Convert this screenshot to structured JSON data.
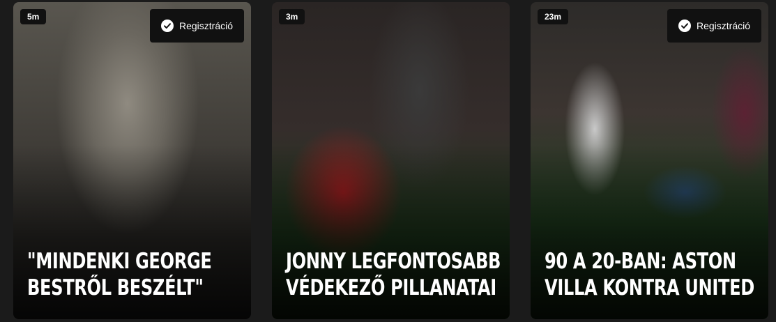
{
  "cards": [
    {
      "time": "5m",
      "register_label": "Regisztráció",
      "title_line1": "\"MINDENKI GEORGE",
      "title_line2": "BESTRŐL BESZÉLT\""
    },
    {
      "time": "3m",
      "register_label": "",
      "title_line1": "JONNY LEGFONTOSABB",
      "title_line2": "VÉDEKEZŐ PILLANATAI"
    },
    {
      "time": "23m",
      "register_label": "Regisztráció",
      "title_line1": "90 A 20-BAN: ASTON",
      "title_line2": "VILLA KONTRA UNITED"
    }
  ],
  "icons": {
    "register": "check-circle-icon"
  },
  "colors": {
    "badge_bg": "#111111",
    "text": "#ffffff",
    "page_bg": "#1b1b1b"
  }
}
